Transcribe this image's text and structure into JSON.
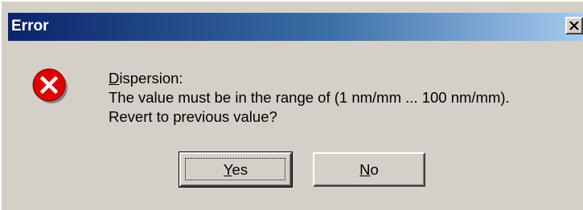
{
  "dialog": {
    "title": "Error",
    "close_icon": "close-icon",
    "icon": "error-icon",
    "message_lines": [
      "Dispersion:",
      "The value must be in the range of (1 nm/mm ... 100 nm/mm).",
      "Revert to previous value?"
    ],
    "buttons": {
      "yes_label": "Yes",
      "no_label": "No"
    }
  },
  "colors": {
    "face": "#d4d0c8",
    "title_start": "#0a246a",
    "title_end": "#a6caf0",
    "error_red": "#e00000"
  }
}
